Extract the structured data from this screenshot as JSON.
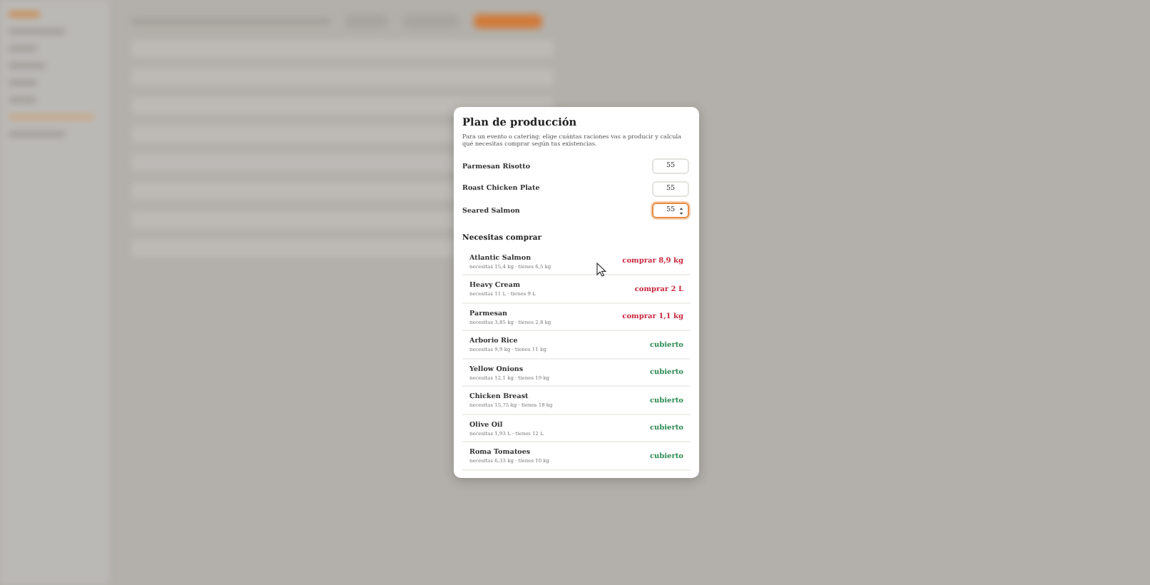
{
  "dialog": {
    "title": "Plan de producción",
    "description": "Para un evento o catering: elige cuántas raciones vas a producir y calcula qué necesitas comprar según tus existencias.",
    "dishes": [
      {
        "name": "Parmesan Risotto",
        "value": "55",
        "focused": false
      },
      {
        "name": "Roast Chicken Plate",
        "value": "55",
        "focused": false
      },
      {
        "name": "Seared Salmon",
        "value": "55",
        "focused": true
      }
    ],
    "section_title": "Necesitas comprar",
    "ingredients": [
      {
        "name": "Atlantic Salmon",
        "detail": "necesitas 15,4 kg · tienes 6,5 kg",
        "status": "comprar 8,9 kg",
        "kind": "buy"
      },
      {
        "name": "Heavy Cream",
        "detail": "necesitas 11 L · tienes 9 L",
        "status": "comprar 2 L",
        "kind": "buy"
      },
      {
        "name": "Parmesan",
        "detail": "necesitas 3,85 kg · tienes 2,8 kg",
        "status": "comprar 1,1 kg",
        "kind": "buy"
      },
      {
        "name": "Arborio Rice",
        "detail": "necesitas 9,9 kg · tienes 11 kg",
        "status": "cubierto",
        "kind": "covered"
      },
      {
        "name": "Yellow Onions",
        "detail": "necesitas 12,1 kg · tienes 19 kg",
        "status": "cubierto",
        "kind": "covered"
      },
      {
        "name": "Chicken Breast",
        "detail": "necesitas 15,75 kg · tienes 18 kg",
        "status": "cubierto",
        "kind": "covered"
      },
      {
        "name": "Olive Oil",
        "detail": "necesitas 1,93 L · tienes 12 L",
        "status": "cubierto",
        "kind": "covered"
      },
      {
        "name": "Roma Tomatoes",
        "detail": "necesitas 6,33 kg · tienes 10 kg",
        "status": "cubierto",
        "kind": "covered"
      }
    ]
  }
}
